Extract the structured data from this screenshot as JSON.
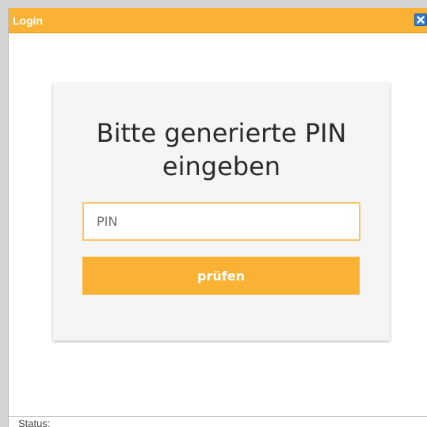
{
  "window": {
    "title": "Login",
    "close_icon": "close-icon"
  },
  "login": {
    "heading": "Bitte generierte PIN\neingeben",
    "pin_placeholder": "PIN",
    "pin_value": "",
    "submit_label": "prüfen"
  },
  "statusbar": {
    "label": "Status:"
  },
  "colors": {
    "accent": "#f9b233",
    "input_border": "#f9c466",
    "close_button": "#2e7bd1",
    "card_background": "#f5f5f5"
  }
}
